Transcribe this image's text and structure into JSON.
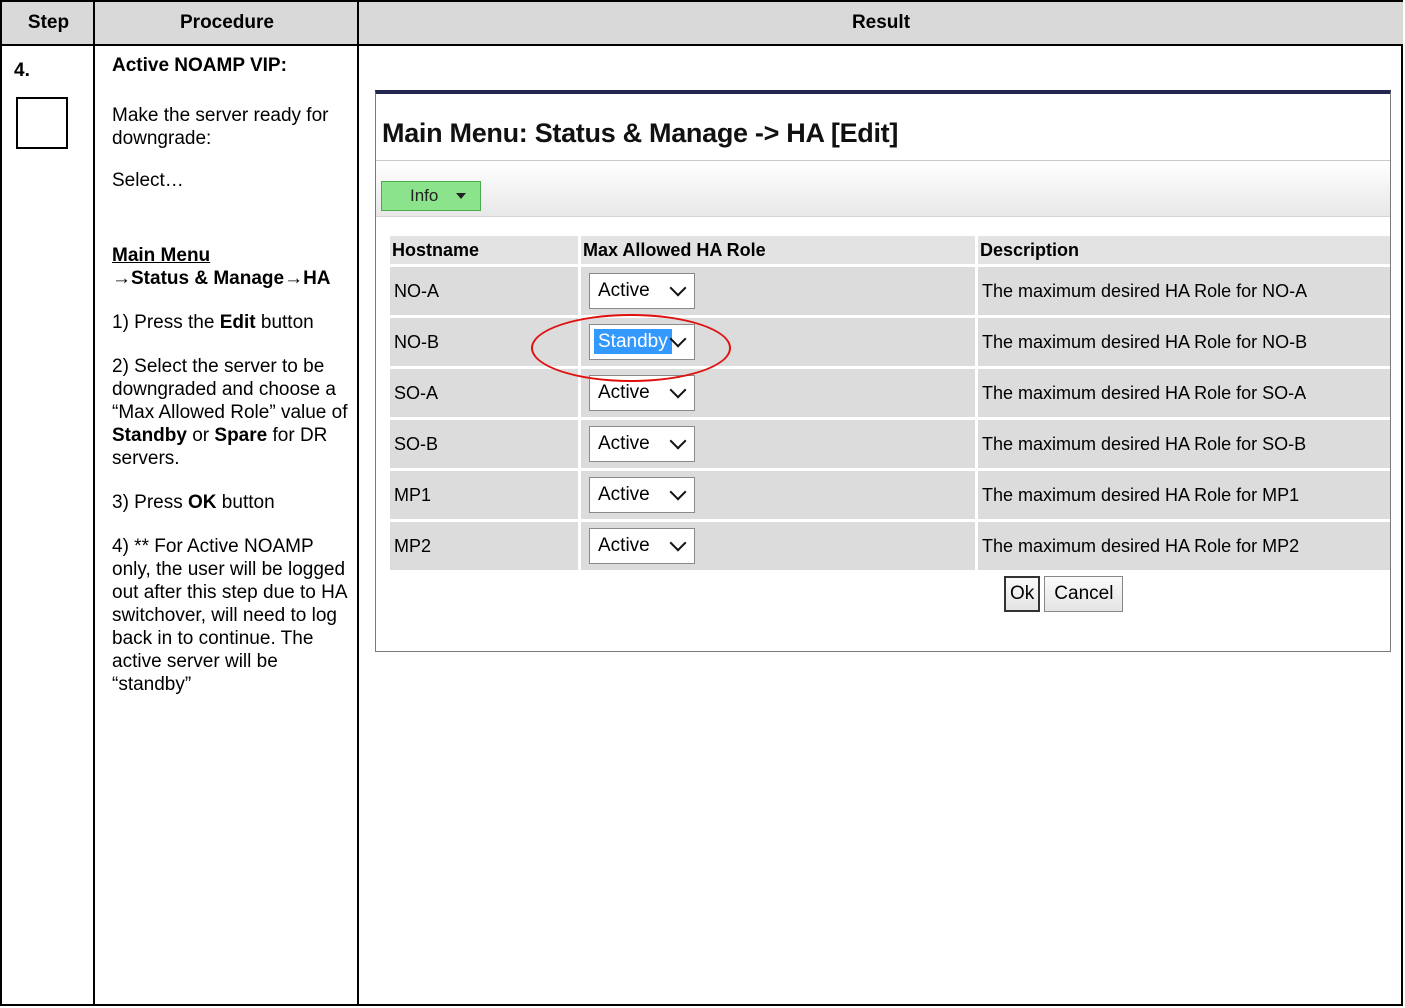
{
  "headers": {
    "step": "Step",
    "procedure": "Procedure",
    "result": "Result"
  },
  "step_number": "4.",
  "procedure": {
    "title": "Active NOAMP VIP:",
    "intro": "Make the server ready for downgrade:",
    "select": "Select…",
    "menu_path_main": "Main Menu",
    "menu_path_rest": "→Status & Manage→HA",
    "step1_pre": "1) Press the ",
    "step1_bold": "Edit",
    "step1_post": " button",
    "step2_pre": "2) Select the server to be downgraded and choose a “Max Allowed Role” value of ",
    "step2_bold1": "Standby",
    "step2_mid": " or ",
    "step2_bold2": "Spare",
    "step2_post": " for DR servers.",
    "step3_pre": "3) Press ",
    "step3_bold": "OK",
    "step3_post": " button",
    "step4": "4) ** For Active NOAMP only, the user will be logged out after this step due to HA switchover, will need to log back in to continue.  The active server will be “standby”"
  },
  "screen": {
    "title": "Main Menu: Status & Manage -> HA [Edit]",
    "info_button": "Info",
    "columns": [
      "Hostname",
      "Max Allowed HA Role",
      "Description"
    ],
    "rows": [
      {
        "hostname": "NO-A",
        "role": "Active",
        "description": "The maximum desired HA Role for NO-A"
      },
      {
        "hostname": "NO-B",
        "role": "Standby",
        "description": "The maximum desired HA Role for NO-B"
      },
      {
        "hostname": "SO-A",
        "role": "Active",
        "description": "The maximum desired HA Role for SO-A"
      },
      {
        "hostname": "SO-B",
        "role": "Active",
        "description": "The maximum desired HA Role for SO-B"
      },
      {
        "hostname": "MP1",
        "role": "Active",
        "description": "The maximum desired HA Role for MP1"
      },
      {
        "hostname": "MP2",
        "role": "Active",
        "description": "The maximum desired HA Role for MP2"
      }
    ],
    "ok_button": "Ok",
    "cancel_button": "Cancel",
    "highlight_color": "#3399ff",
    "annotation_color": "#e01010"
  }
}
